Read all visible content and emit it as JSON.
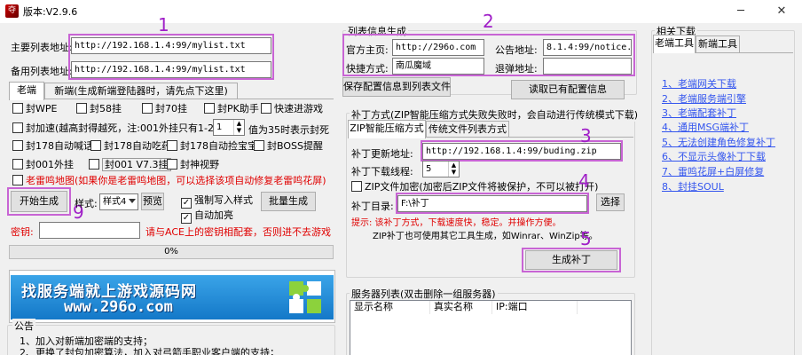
{
  "window": {
    "title": "版本:V2.9.6",
    "icon_text": "夺",
    "minimize": "─",
    "maximize": "☐",
    "close": "✕"
  },
  "left": {
    "main_list_label": "主要列表地址:",
    "main_list_value": "http://192.168.1.4:99/mylist.txt",
    "backup_list_label": "备用列表地址:",
    "backup_list_value": "http://192.168.1.4:99/mylist.txt",
    "tabs": [
      "老端",
      "新端(生成新端登陆器时，请先点下这里)"
    ],
    "checks": [
      {
        "label": "封WPE",
        "checked": false
      },
      {
        "label": "封58挂",
        "checked": false
      },
      {
        "label": "封70挂",
        "checked": false
      },
      {
        "label": "封PK助手",
        "checked": false
      },
      {
        "label": "快速进游戏",
        "checked": false
      },
      {
        "label": "封加速(越高封得越死，注:001外挂只有1-20值)",
        "checked": false
      },
      {
        "label": "封178自动喊话",
        "checked": false
      },
      {
        "label": "封178自动吃药",
        "checked": false
      },
      {
        "label": "封178自动捡宝宝",
        "checked": false
      },
      {
        "label": "封BOSS提醒",
        "checked": false
      },
      {
        "label": "封001外挂",
        "checked": false
      },
      {
        "label": "封001 V7.3挂",
        "checked": false
      },
      {
        "label": "封神视野",
        "checked": false
      },
      {
        "label": "老雷鸣地图(如果你是老雷鸣地图，可以选择该项自动修复老雷鸣花屏)",
        "checked": false
      }
    ],
    "speed_value": "1",
    "speed_hint": "值为35时表示封死",
    "generate_button": "开始生成",
    "style_label": "样式:",
    "style_value": "样式4",
    "preview_button": "预览",
    "force_write": {
      "label": "强制写入样式",
      "checked": true
    },
    "auto_light": {
      "label": "自动加亮",
      "checked": true
    },
    "batch_button": "批量生成",
    "key_label": "密钥:",
    "key_value": "",
    "key_hint": "请与ACE上的密钥相配套，否则进不去游戏",
    "progress": "0%",
    "progress_fraction": 0,
    "banner_line1": "找服务端就上游戏源码网",
    "banner_line2": "www.296o.com",
    "notice_title": "公告",
    "notice_lines": [
      "1、加入对新端加密端的支持；",
      "2、更换了封包加密算法，加入对弓箭手职业客户端的支持；"
    ]
  },
  "middle": {
    "group_title": "列表信息生成",
    "homepage_label": "官方主页:",
    "homepage_value": "http://296o.com",
    "notice_label": "公告地址:",
    "notice_value": "8.1.4:99/notice.htm",
    "shortcut_label": "快捷方式:",
    "shortcut_value": "南瓜魔域",
    "popup_label": "退弹地址:",
    "popup_value": "",
    "save_button": "保存配置信息到列表文件",
    "read_button": "读取已有配置信息",
    "patch_group_title": "补丁方式(ZIP智能压缩方式失败失败时，会自动进行传统模式下载)",
    "patch_tabs": [
      "ZIP智能压缩方式",
      "传统文件列表方式"
    ],
    "update_label": "补丁更新地址:",
    "update_value": "http://192.168.1.4:99/buding.zip",
    "threads_label": "补丁下载线程:",
    "threads_value": "5",
    "zip_encrypt": {
      "label": "ZIP文件加密(加密后ZIP文件将被保护，不可以被打开)",
      "checked": false
    },
    "dir_label": "补丁目录:",
    "dir_value": "F:\\补丁",
    "select_button": "选择",
    "tip_line": "提示: 该补丁方式，下载速度快，稳定。并操作方便。",
    "tip_line2": "ZIP补丁也可使用其它工具生成，如Winrar、WinZip等。",
    "gen_patch_button": "生成补丁",
    "server_group_title": "服务器列表(双击删除一组服务器)",
    "server_columns": [
      "显示名称",
      "真实名称",
      "IP:端口"
    ]
  },
  "right": {
    "group_title": "相关下载",
    "tabs": [
      "老端工具",
      "新端工具"
    ],
    "links": [
      "1、老端网关下载",
      "2、老端服务端引擎",
      "3、老端配套补丁",
      "4、通用MSG端补丁",
      "5、无法创建角色修复补丁",
      "6、不显示头像补丁下载",
      "7、雷鸣花屏+白屏修复",
      "8、封挂SOUL"
    ]
  },
  "annotations": [
    "1",
    "2",
    "3",
    "4",
    "5",
    "9"
  ]
}
